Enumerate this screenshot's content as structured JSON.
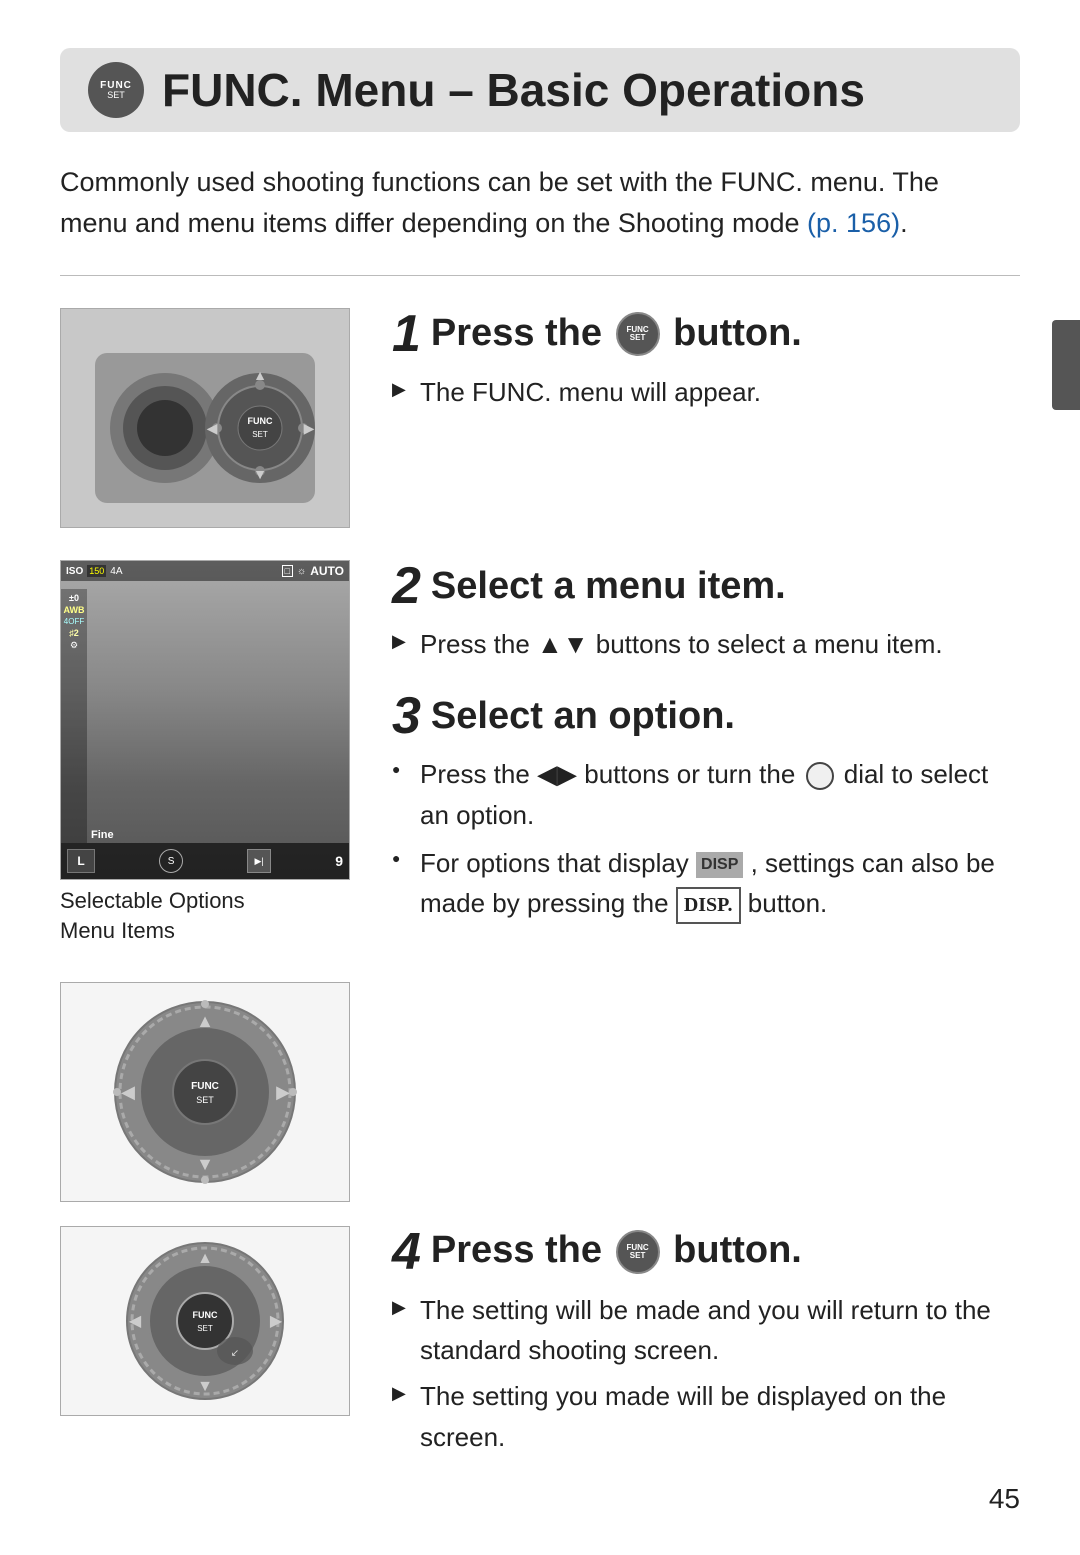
{
  "header": {
    "title": "FUNC. Menu – Basic Operations",
    "icon_top": "FUNC",
    "icon_bottom": "SET"
  },
  "intro": {
    "line1": "Commonly used shooting functions can be set with the FUNC. menu. The",
    "line2": "menu and menu items differ depending on the Shooting mode",
    "link": "(p. 156)",
    "period": "."
  },
  "steps": [
    {
      "number": "1",
      "title": "Press the",
      "title_suffix": "button.",
      "bullets": [
        {
          "type": "arrow",
          "text": "The FUNC. menu will appear."
        }
      ],
      "image_alt": "Camera showing FUNC button"
    },
    {
      "number": "2",
      "title": "Select a menu item.",
      "bullets": [
        {
          "type": "arrow",
          "text": "Press the ▲▼ buttons to select a menu item."
        }
      ]
    },
    {
      "number": "3",
      "title": "Select an option.",
      "bullets": [
        {
          "type": "bullet",
          "text": "Press the ◀▶ buttons or turn the dial to select an option."
        },
        {
          "type": "bullet",
          "text": "For options that display DISP , settings can also be made by pressing the DISP. button."
        }
      ],
      "image_captions": [
        "Selectable Options",
        "Menu Items"
      ]
    },
    {
      "number": "4",
      "title": "Press the",
      "title_suffix": "button.",
      "bullets": [
        {
          "type": "arrow",
          "text": "The setting will be made and you will return to the standard shooting screen."
        },
        {
          "type": "arrow",
          "text": "The setting you made will be displayed on the screen."
        }
      ],
      "image_alt": "Camera FUNC dial pressed"
    }
  ],
  "page_number": "45"
}
